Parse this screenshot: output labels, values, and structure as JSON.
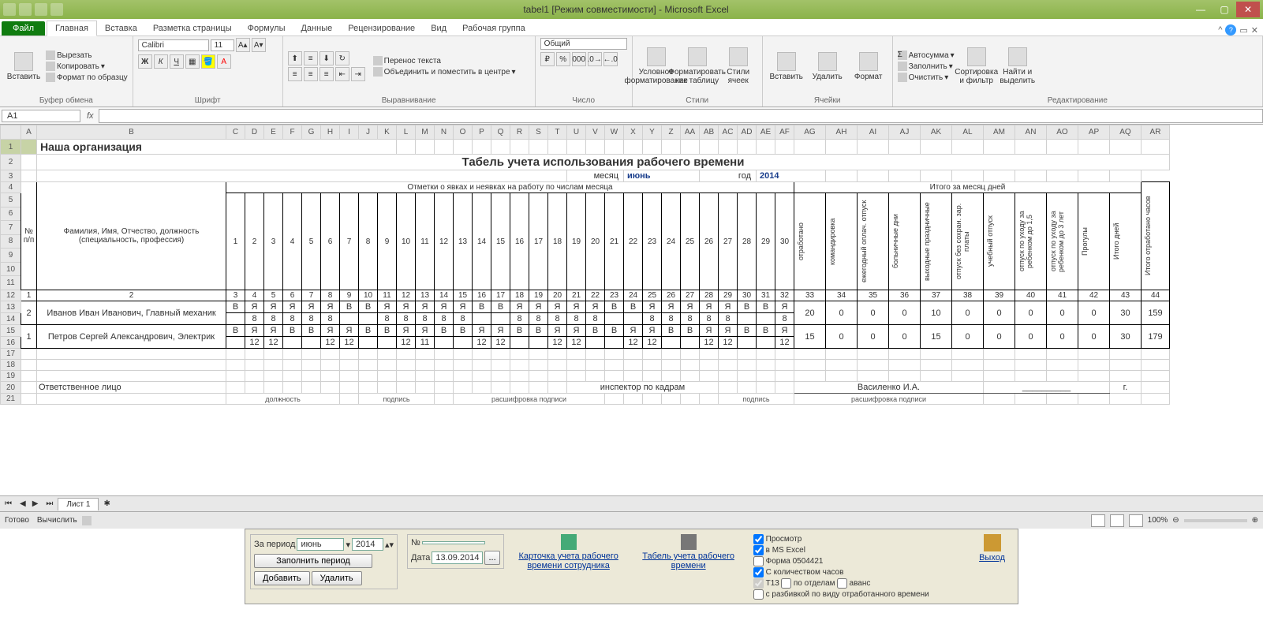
{
  "titlebar": {
    "title": "tabel1  [Режим совместимости] - Microsoft Excel"
  },
  "tabs": {
    "file": "Файл",
    "items": [
      "Главная",
      "Вставка",
      "Разметка страницы",
      "Формулы",
      "Данные",
      "Рецензирование",
      "Вид",
      "Рабочая группа"
    ],
    "active": 0
  },
  "ribbon": {
    "clipboard": {
      "paste": "Вставить",
      "cut": "Вырезать",
      "copy": "Копировать",
      "formatpainter": "Формат по образцу",
      "label": "Буфер обмена"
    },
    "font": {
      "name": "Calibri",
      "size": "11",
      "label": "Шрифт"
    },
    "align": {
      "wrap": "Перенос текста",
      "merge": "Объединить и поместить в центре",
      "label": "Выравнивание"
    },
    "number": {
      "format": "Общий",
      "label": "Число"
    },
    "styles": {
      "cond": "Условное форматирование",
      "table": "Форматировать как таблицу",
      "cell": "Стили ячеек",
      "label": "Стили"
    },
    "cells": {
      "insert": "Вставить",
      "delete": "Удалить",
      "format": "Формат",
      "label": "Ячейки"
    },
    "editing": {
      "sum": "Автосумма",
      "fill": "Заполнить",
      "clear": "Очистить",
      "sort": "Сортировка и фильтр",
      "find": "Найти и выделить",
      "label": "Редактирование"
    }
  },
  "namebox": "A1",
  "sheet": {
    "cols": [
      "A",
      "B",
      "C",
      "D",
      "E",
      "F",
      "G",
      "H",
      "I",
      "J",
      "K",
      "L",
      "M",
      "N",
      "O",
      "P",
      "Q",
      "R",
      "S",
      "T",
      "U",
      "V",
      "W",
      "X",
      "Y",
      "Z",
      "AA",
      "AB",
      "AC",
      "AD",
      "AE",
      "AF",
      "AG",
      "AH",
      "AI",
      "AJ",
      "AK",
      "AL",
      "AM",
      "AN",
      "AO",
      "AP",
      "AQ",
      "AR"
    ],
    "org": "Наша организация",
    "title": "Табель учета использования рабочего времени",
    "monthLabel": "месяц",
    "month": "июнь",
    "yearLabel": "год",
    "year": "2014",
    "header": {
      "np": "№ п/п",
      "fio": "Фамилия, Имя, Отчество, должность (специальность, профессия)",
      "marks": "Отметки о явках и неявках на работу по числам месяца",
      "days": [
        "1",
        "2",
        "3",
        "4",
        "5",
        "6",
        "7",
        "8",
        "9",
        "10",
        "11",
        "12",
        "13",
        "14",
        "15",
        "16",
        "17",
        "18",
        "19",
        "20",
        "21",
        "22",
        "23",
        "24",
        "25",
        "26",
        "27",
        "28",
        "29",
        "30"
      ],
      "totalMonth": "Итого за месяц дней",
      "totals": [
        "отработано",
        "командировка",
        "ежегодный оплач. отпуск",
        "больничные дни",
        "выходные праздничные",
        "отпуск без сохран. зар. платы",
        "учебный отпуск",
        "отпуск по уходу за ребенком до 1,5",
        "отпуск по уходу за ребенком до 3 лет",
        "Прогулы",
        "Итого дней"
      ],
      "totalHours": "Итого отработано часов"
    },
    "numRow": [
      "1",
      "2",
      "3",
      "4",
      "5",
      "6",
      "7",
      "8",
      "9",
      "10",
      "11",
      "12",
      "13",
      "14",
      "15",
      "16",
      "17",
      "18",
      "19",
      "20",
      "21",
      "22",
      "23",
      "24",
      "25",
      "26",
      "27",
      "28",
      "29",
      "30",
      "31",
      "32",
      "33",
      "34",
      "35",
      "36",
      "37",
      "38",
      "39",
      "40",
      "41",
      "42",
      "43",
      "44"
    ],
    "rows": [
      {
        "n": "2",
        "fio": "Иванов Иван Иванович, Главный механик",
        "marks": [
          "В",
          "Я",
          "Я",
          "Я",
          "Я",
          "Я",
          "В",
          "В",
          "Я",
          "Я",
          "Я",
          "Я",
          "Я",
          "В",
          "В",
          "Я",
          "Я",
          "Я",
          "Я",
          "Я",
          "В",
          "В",
          "Я",
          "Я",
          "Я",
          "Я",
          "Я",
          "В",
          "В",
          "Я"
        ],
        "hours": [
          "",
          "8",
          "8",
          "8",
          "8",
          "8",
          "",
          "",
          "8",
          "8",
          "8",
          "8",
          "8",
          "",
          "",
          "8",
          "8",
          "8",
          "8",
          "8",
          "",
          "",
          "8",
          "8",
          "8",
          "8",
          "8",
          "",
          "",
          "8"
        ],
        "totals": [
          "20",
          "0",
          "0",
          "0",
          "10",
          "0",
          "0",
          "0",
          "0",
          "0",
          "30",
          "159"
        ]
      },
      {
        "n": "1",
        "fio": "Петров Сергей Александрович, Электрик",
        "marks": [
          "В",
          "Я",
          "Я",
          "В",
          "В",
          "Я",
          "Я",
          "В",
          "В",
          "Я",
          "Я",
          "В",
          "В",
          "Я",
          "Я",
          "В",
          "В",
          "Я",
          "Я",
          "В",
          "В",
          "Я",
          "Я",
          "В",
          "В",
          "Я",
          "Я",
          "В",
          "В",
          "Я"
        ],
        "hours": [
          "",
          "12",
          "12",
          "",
          "",
          "12",
          "12",
          "",
          "",
          "12",
          "11",
          "",
          "",
          "12",
          "12",
          "",
          "",
          "12",
          "12",
          "",
          "",
          "12",
          "12",
          "",
          "",
          "12",
          "12",
          "",
          "",
          "12"
        ],
        "totals": [
          "15",
          "0",
          "0",
          "0",
          "15",
          "0",
          "0",
          "0",
          "0",
          "0",
          "30",
          "179"
        ]
      }
    ],
    "footer": {
      "resp": "Ответственное лицо",
      "post": "должность",
      "sign": "подпись",
      "decode": "расшифровка подписи",
      "insp": "инспектор по кадрам",
      "inspName": "Василенко И.А.",
      "g": "г."
    },
    "sheetname": "Лист 1"
  },
  "status": {
    "ready": "Готово",
    "calc": "Вычислить",
    "zoom": "100%"
  },
  "ext": {
    "period": "За период",
    "month": "июнь",
    "year": "2014",
    "fill": "Заполнить период",
    "add": "Добавить",
    "del": "Удалить",
    "numLabel": "№",
    "dateLabel": "Дата",
    "date": "13.09.2014",
    "card": "Карточка учета рабочего времени сотрудника",
    "tabel": "Табель учета рабочего времени",
    "preview": "Просмотр",
    "msexcel": "в MS Excel",
    "form": "Форма 0504421",
    "withHours": "С количеством часов",
    "t13": "Т13",
    "bydept": "по отделам",
    "advance": "аванс",
    "split": "с разбивкой по виду отработанного времени",
    "exit": "Выход"
  }
}
